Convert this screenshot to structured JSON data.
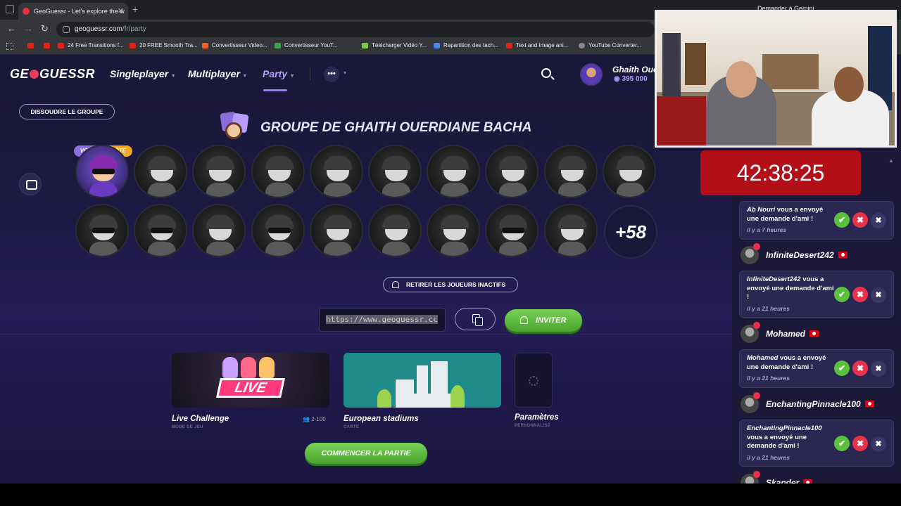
{
  "browser": {
    "tab_title": "GeoGuessr - Let's explore the w",
    "tab_close": "✕",
    "new_tab": "+",
    "url_domain": "geoguessr.com",
    "url_path": "/fr/party",
    "gemini": "Demander à Gemini",
    "nav_back": "←",
    "nav_forward": "→",
    "nav_reload": "↻",
    "bookmarks": [
      "24 Free Transitions f...",
      "20 FREE Smooth Tra...",
      "Convertisseur Video...",
      "Convertisseur YouT...",
      "Télécharger Vidéo Y...",
      "Repartition des tach...",
      "Text and Image ani...",
      "YouTube Converter..."
    ]
  },
  "header": {
    "logo_left": "GE",
    "logo_right": "GUESSR",
    "menu": [
      "Singleplayer",
      "Multiplayer",
      "Party"
    ],
    "more": "•••",
    "user_name": "Ghaith Oue",
    "coins": "395 000"
  },
  "party": {
    "dissolve": "DISSOUDRE LE GROUPE",
    "title": "GROUPE DE GHAITH OUERDIANE BACHA",
    "badge_you": "VOUS",
    "badge_host": "HÔTE",
    "more_players": "+58",
    "remove_inactive": "RETIRER LES JOUEURS INACTIFS",
    "invite_link": "https://www.geoguessr.cc",
    "invite": "INVITER"
  },
  "settings": {
    "cards": [
      {
        "title": "Live Challenge",
        "sub": "MODE DE JEU",
        "players": "2-100"
      },
      {
        "title": "European stadiums",
        "sub": "CARTE"
      },
      {
        "title": "Paramètres",
        "sub": "PERSONNALISÉ"
      }
    ],
    "live_label": "LIVE",
    "start": "COMMENCER LA PARTIE"
  },
  "overlay": {
    "timer": "42:38:25"
  },
  "notifications": [
    {
      "user": "Ab Nouri",
      "text": " vous a envoyé une demande d'ami !",
      "time": "il y a 7 heures"
    },
    {
      "user": "InfiniteDesert242",
      "text": " vous a envoyé une demande d'ami !",
      "time": "il y a 21 heures"
    },
    {
      "user": "Mohamed",
      "text": " vous a envoyé une demande d'ami !",
      "time": "il y a 21 heures"
    },
    {
      "user": "EnchantingPinnacle100",
      "text": " vous a envoyé une demande d'ami !",
      "time": "il y a 21 heures"
    }
  ],
  "user_lines": [
    "InfiniteDesert242",
    "Mohamed",
    "EnchantingPinnacle100",
    "Skander"
  ],
  "actions": {
    "accept": "✔",
    "decline": "✖",
    "close": "✖"
  }
}
